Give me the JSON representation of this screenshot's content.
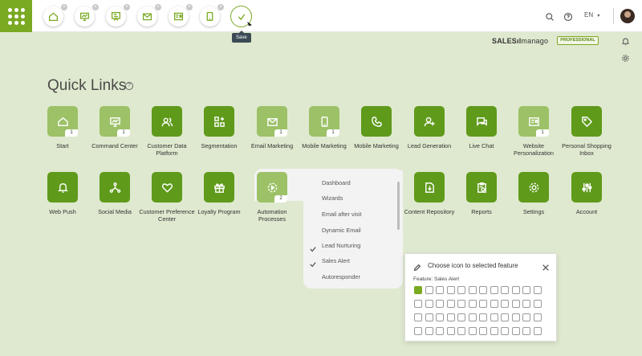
{
  "topbar": {
    "shortcuts": [
      "home-icon",
      "monitor-icon",
      "presentation-icon",
      "mail-icon",
      "id-card-icon",
      "mobile-icon"
    ],
    "save_tooltip": "Save",
    "language": "EN"
  },
  "brand": {
    "name_bold": "SALES",
    "name_rest": "manago",
    "badge": "PROFESSIONAL"
  },
  "quick_links": {
    "title": "Quick Links",
    "row1": [
      {
        "label": "Start",
        "count": "1",
        "icon": "home-icon"
      },
      {
        "label": "Command Center",
        "count": "1",
        "icon": "monitor-chart-icon"
      },
      {
        "label": "Customer Data Platform",
        "count": "",
        "icon": "users-icon"
      },
      {
        "label": "Segmentation",
        "count": "",
        "icon": "grid-plus-icon"
      },
      {
        "label": "Email Marketing",
        "count": "1",
        "icon": "mail-icon"
      },
      {
        "label": "Mobile Marketing",
        "count": "1",
        "icon": "mobile-icon"
      },
      {
        "label": "Mobile Marketing",
        "count": "",
        "icon": "phone-icon"
      },
      {
        "label": "Lead Generation",
        "count": "",
        "icon": "user-plus-icon"
      },
      {
        "label": "Live Chat",
        "count": "",
        "icon": "chat-icon"
      },
      {
        "label": "Website Personalization",
        "count": "1",
        "icon": "id-card-icon"
      },
      {
        "label": "Personal Shopping Inbox",
        "count": "",
        "icon": "tag-icon"
      }
    ],
    "row2": [
      {
        "label": "Web Push",
        "count": "",
        "icon": "bell-icon"
      },
      {
        "label": "Social Media",
        "count": "",
        "icon": "share-icon"
      },
      {
        "label": "Customer Preference Center",
        "count": "",
        "icon": "heart-icon"
      },
      {
        "label": "Loyalty Program",
        "count": "",
        "icon": "gift-icon"
      },
      {
        "label": "Automation Processes",
        "count": "2",
        "icon": "gear-play-icon"
      },
      {
        "label": "Content Repository",
        "count": "",
        "icon": "document-icon"
      },
      {
        "label": "Reports",
        "count": "",
        "icon": "clipboard-icon"
      },
      {
        "label": "Settings",
        "count": "",
        "icon": "gear-icon"
      },
      {
        "label": "Account",
        "count": "",
        "icon": "sliders-icon"
      }
    ]
  },
  "dropdown": {
    "items": [
      {
        "label": "Dashboard",
        "checked": false
      },
      {
        "label": "Wizards",
        "checked": false
      },
      {
        "label": "Email after visit",
        "checked": false
      },
      {
        "label": "Dynamic Email",
        "checked": false
      },
      {
        "label": "Lead Nurturing",
        "checked": true
      },
      {
        "label": "Sales Alert",
        "checked": true
      },
      {
        "label": "Autoresponder",
        "checked": false
      }
    ]
  },
  "picker": {
    "title": "Choose icon to selected feature",
    "feature_label": "Feature: Sales Alert"
  },
  "colors": {
    "accent": "#7aa922",
    "tile_dark": "#5f9a1b",
    "tile_light": "#9cc167",
    "background": "#dfe9cf"
  }
}
